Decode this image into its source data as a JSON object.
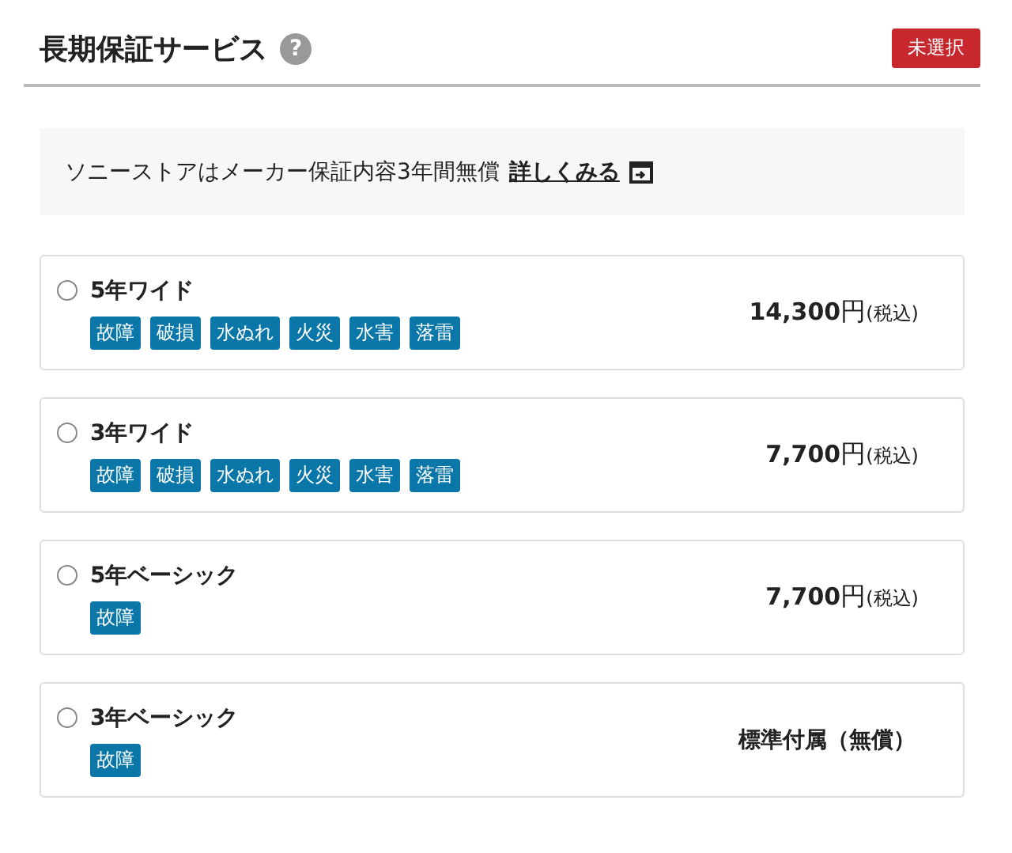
{
  "header": {
    "title": "長期保証サービス",
    "help_icon": "?",
    "status_badge": "未選択"
  },
  "notice": {
    "text": "ソニーストアはメーカー保証内容3年間無償",
    "link": "詳しくみる"
  },
  "options": [
    {
      "name": "5年ワイド",
      "selected": false,
      "tags": [
        "故障",
        "破損",
        "水ぬれ",
        "火災",
        "水害",
        "落雷"
      ],
      "price": {
        "kind": "amount",
        "amount": "14,300",
        "unit": "円",
        "note": "(税込)"
      }
    },
    {
      "name": "3年ワイド",
      "selected": false,
      "tags": [
        "故障",
        "破損",
        "水ぬれ",
        "火災",
        "水害",
        "落雷"
      ],
      "price": {
        "kind": "amount",
        "amount": "7,700",
        "unit": "円",
        "note": "(税込)"
      }
    },
    {
      "name": "5年ベーシック",
      "selected": false,
      "tags": [
        "故障"
      ],
      "price": {
        "kind": "amount",
        "amount": "7,700",
        "unit": "円",
        "note": "(税込)"
      }
    },
    {
      "name": "3年ベーシック",
      "selected": false,
      "tags": [
        "故障"
      ],
      "price": {
        "kind": "label",
        "label": "標準付属（無償）"
      }
    }
  ]
}
